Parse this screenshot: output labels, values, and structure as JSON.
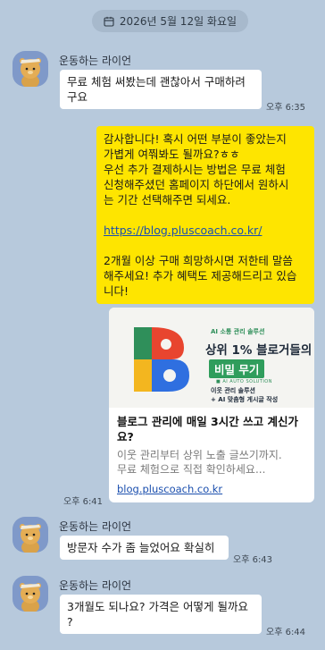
{
  "date_divider": {
    "text": "2026년 5월 12일 화요일",
    "icon": "calendar-icon"
  },
  "contact_name": "운동하는 라이언",
  "messages": [
    {
      "id": "m1",
      "from": "contact",
      "text": "무료 체험 써봤는데 괜찮아서 구매하려\n구요",
      "time": "오후 6:35"
    },
    {
      "id": "m2",
      "from": "me",
      "text_before_link": "감사합니다! 혹시 어떤 부분이 좋았는지\n가볍게 여쭤봐도 될까요?ㅎㅎ\n우선 추가 결제하시는 방법은 무료 체험\n신청해주셨던 홈페이지 하단에서 원하시\n는 기간 선택해주면 되세요.\n\n",
      "link": "https://blog.pluscoach.co.kr/",
      "text_after_link": "\n\n2개월 이상 구매 희망하시면 저한테 말씀\n해주세요! 추가 혜택도 제공해드리고 있습\n니다!"
    },
    {
      "id": "m3",
      "from": "me",
      "type": "link_preview",
      "time": "오후 6:41",
      "preview": {
        "badge": "AI 소통 관리 솔루션",
        "headline_top": "상위 1% 블로거들의",
        "headline_bottom": "비밀 무기",
        "subbrand": "■ AI AUTO SOLUTION",
        "bullet1": "이웃 관리 솔루션",
        "bullet2": "+ AI 맞춤형 게시글 작성",
        "title": "블로그 관리에 매일 3시간 쓰고 계신가요?",
        "description": "이웃 관리부터 상위 노출 글쓰기까지.\n무료 체험으로 직접 확인하세요...",
        "url": "blog.pluscoach.co.kr"
      }
    },
    {
      "id": "m4",
      "from": "contact",
      "text": "방문자 수가 좀 늘었어요 확실히",
      "time": "오후 6:43"
    },
    {
      "id": "m5",
      "from": "contact",
      "text": "3개월도 되나요? 가격은 어떻게 될까요\n?",
      "time": "오후 6:44"
    }
  ],
  "colors": {
    "background": "#b7c9dc",
    "my_bubble": "#fee500",
    "their_bubble": "#ffffff",
    "link": "#1b4fae"
  }
}
